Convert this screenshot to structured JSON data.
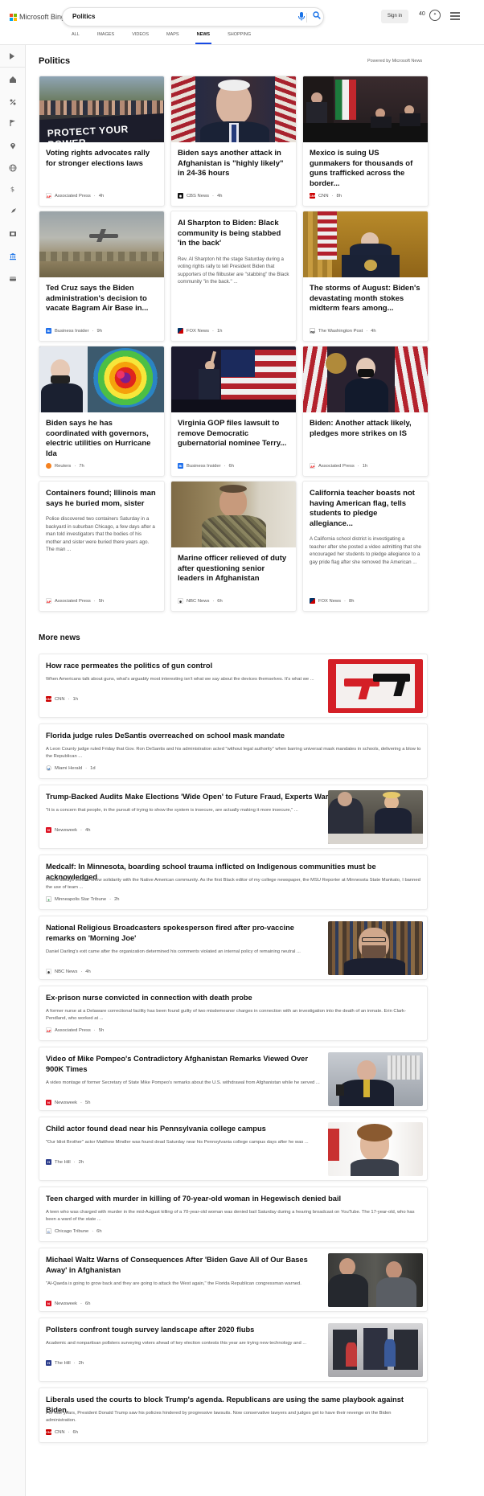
{
  "header": {
    "logo_text": "Microsoft Bing",
    "search_query": "Politics",
    "signin_label": "Sign in",
    "rewards_points": "40",
    "tabs": [
      "ALL",
      "IMAGES",
      "VIDEOS",
      "MAPS",
      "NEWS",
      "SHOPPING"
    ],
    "active_tab": "NEWS"
  },
  "colors": {
    "accent": "#174ae4",
    "logo_red": "#f25022",
    "logo_green": "#7fba00",
    "logo_blue": "#00a4ef",
    "logo_yellow": "#ffb900"
  },
  "section": {
    "title": "Politics",
    "powered": "Powered by Microsoft News"
  },
  "cards": [
    {
      "title": "Voting rights advocates rally for stronger elections laws",
      "source": "Associated Press",
      "time": "4h",
      "icon": "ap-icon",
      "image": "protest-banner-image",
      "banner_text": "PROTECT YOUR POWER"
    },
    {
      "title": "Biden says another attack in Afghanistan is \"highly likely\" in 24-36 hours",
      "source": "CBS News",
      "time": "4h",
      "icon": "cbs-icon",
      "image": "biden-portrait-image"
    },
    {
      "title": "Mexico is suing US gunmakers for thousands of guns trafficked across the border...",
      "source": "CNN",
      "time": "8h",
      "icon": "cnn-icon",
      "image": "mexico-press-image"
    },
    {
      "title": "Ted Cruz says the Biden administration's decision to vacate Bagram Air Base in...",
      "source": "Business Insider",
      "time": "9h",
      "icon": "business-insider-icon",
      "image": "airbase-plane-image"
    },
    {
      "title": "Al Sharpton to Biden: Black community is being stabbed 'in the back'",
      "snippet": "Rev. Al Sharpton hit the stage Saturday during a voting rights rally to tell President Biden that supporters of the filibuster are \"stabbing\" the Black community \"in the back.\" ...",
      "source": "FOX News",
      "time": "1h",
      "icon": "fox-icon"
    },
    {
      "title": "The storms of August: Biden's devastating month stokes midterm fears among...",
      "source": "The Washington Post",
      "time": "4h",
      "icon": "wapo-icon",
      "image": "biden-podium-image"
    },
    {
      "title": "Biden says he has coordinated with governors, electric utilities on Hurricane Ida",
      "source": "Reuters",
      "time": "7h",
      "icon": "reuters-icon",
      "image": "hurricane-map-image"
    },
    {
      "title": "Virginia GOP files lawsuit to remove Democratic gubernatorial nominee Terry...",
      "source": "Business Insider",
      "time": "6h",
      "icon": "business-insider-icon",
      "image": "rally-flag-image"
    },
    {
      "title": "Biden: Another attack likely, pledges more strikes on IS",
      "source": "Associated Press",
      "time": "1h",
      "icon": "ap-icon",
      "image": "biden-flags-image"
    },
    {
      "title": "Containers found; Illinois man says he buried mom, sister",
      "snippet": "Police discovered two containers Saturday in a backyard in suburban Chicago, a few days after a man told investigators that the bodies of his mother and sister were buried there years ago. The man ...",
      "source": "Associated Press",
      "time": "5h",
      "icon": "ap-icon"
    },
    {
      "title": "Marine officer relieved of duty after questioning senior leaders in Afghanistan",
      "source": "NBC News",
      "time": "6h",
      "icon": "nbc-icon",
      "image": "marine-officer-image"
    },
    {
      "title": "California teacher boasts not having American flag, tells students to pledge allegiance...",
      "snippet": "A California school district is investigating a teacher after she posted a video admitting that she encouraged her students to pledge allegiance to a gay pride flag after she removed the American ...",
      "source": "FOX News",
      "time": "8h",
      "icon": "fox-icon"
    }
  ],
  "more_news": {
    "title": "More news",
    "items": [
      {
        "title": "How race permeates the politics of gun control",
        "snippet": "When Americans talk about guns, what's arguably most interesting isn't what we say about the devices themselves. It's what we ...",
        "source": "CNN",
        "time": "1h",
        "icon": "cnn-icon",
        "image": "gun-illustration-image"
      },
      {
        "title": "Florida judge rules DeSantis overreached on school mask mandate",
        "snippet": "A Leon County judge ruled Friday that Gov. Ron DeSantis and his administration acted \"without legal authority\" when barring universal mask mandates in schools, delivering a blow to the Republican ...",
        "source": "Miami Herald",
        "time": "1d",
        "icon": "miami-herald-icon"
      },
      {
        "title": "Trump-Backed Audits Make Elections 'Wide Open' to Future Fraud, Experts Warn",
        "snippet": "\"It is a concern that people, in the pursuit of trying to show the system is insecure, are actually making it more insecure,\" ...",
        "source": "Newsweek",
        "time": "4h",
        "icon": "newsweek-icon",
        "image": "trump-meeting-image"
      },
      {
        "title": "Medcalf: In Minnesota, boarding school trauma inflicted on Indigenous communities must be acknowledged",
        "snippet": "I have always tried to show solidarity with the Native American community. As the first Black editor of my college newspaper, the MSU Reporter at Minnesota State Mankato, I banned the use of team ...",
        "source": "Minneapolis Star Tribune",
        "time": "2h",
        "icon": "star-tribune-icon"
      },
      {
        "title": "National Religious Broadcasters spokesperson fired after pro-vaccine remarks on 'Morning Joe'",
        "snippet": "Daniel Darling's exit came after the organization determined his comments violated an internal policy of remaining neutral ...",
        "source": "NBC News",
        "time": "4h",
        "icon": "nbc-icon",
        "image": "spokesperson-image"
      },
      {
        "title": "Ex-prison nurse convicted in connection with death probe",
        "snippet": "A former nurse at a Delaware correctional facility has been found guilty of two misdemeanor charges in connection with an investigation into the death of an inmate. Erin Clark-Pendland, who worked at ...",
        "source": "Associated Press",
        "time": "5h",
        "icon": "ap-icon"
      },
      {
        "title": "Video of Mike Pompeo's Contradictory Afghanistan Remarks Viewed Over 900K Times",
        "snippet": "A video montage of former Secretary of State Mike Pompeo's remarks about the U.S. withdrawal from Afghanistan while he served ...",
        "source": "Newsweek",
        "time": "5h",
        "icon": "newsweek-icon",
        "image": "pompeo-image"
      },
      {
        "title": "Child actor found dead near his Pennsylvania college campus",
        "snippet": "\"Our Idiot Brother\" actor Matthew Mindler was found dead Saturday near his Pennsylvania college campus days after he was ...",
        "source": "The Hill",
        "time": "2h",
        "icon": "the-hill-icon",
        "image": "child-actor-image"
      },
      {
        "title": "Teen charged with murder in killing of 70-year-old woman in Hegewisch denied bail",
        "snippet": "A teen who was charged with murder in the mid-August killing of a 70-year-old woman was denied bail Saturday during a hearing broadcast on YouTube. The 17-year-old, who has been a ward of the state ...",
        "source": "Chicago Tribune",
        "time": "6h",
        "icon": "chicago-tribune-icon"
      },
      {
        "title": "Michael Waltz Warns of Consequences After 'Biden Gave All of Our Bases Away' in Afghanistan",
        "snippet": "\"Al-Qaeda is going to grow back and they are going to attack the West again,\" the Florida Republican congressman warned.",
        "source": "Newsweek",
        "time": "6h",
        "icon": "newsweek-icon",
        "image": "waltz-image"
      },
      {
        "title": "Pollsters confront tough survey landscape after 2020 flubs",
        "snippet": "Academic and nonpartisan pollsters surveying voters ahead of key election contests this year are trying new technology and ...",
        "source": "The Hill",
        "time": "2h",
        "icon": "the-hill-icon",
        "image": "voting-booth-image"
      },
      {
        "title": "Liberals used the courts to block Trump's agenda. Republicans are using the same playbook against Biden.",
        "snippet": "For four years, President Donald Trump saw his policies hindered by progressive lawsuits. Now conservative lawyers and judges get to have their revenge on the Biden administration.",
        "source": "CNN",
        "time": "6h",
        "icon": "cnn-icon"
      }
    ]
  }
}
